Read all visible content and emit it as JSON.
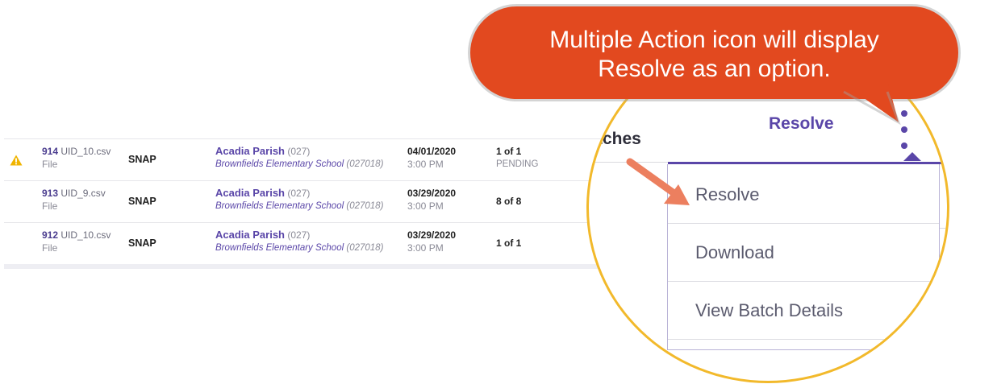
{
  "table": {
    "rows": [
      {
        "warning": true,
        "id": "914",
        "file_name": "UID_10.csv",
        "file_type": "File",
        "program": "SNAP",
        "district": "Acadia Parish",
        "district_code": "(027)",
        "school": "Brownfields Elementary School",
        "school_code": "(027018)",
        "date": "04/01/2020",
        "time": "3:00 PM",
        "count": "1 of 1",
        "status": "PENDING"
      },
      {
        "warning": false,
        "id": "913",
        "file_name": "UID_9.csv",
        "file_type": "File",
        "program": "SNAP",
        "district": "Acadia Parish",
        "district_code": "(027)",
        "school": "Brownfields Elementary School",
        "school_code": "(027018)",
        "date": "03/29/2020",
        "time": "3:00 PM",
        "count": "8 of 8",
        "status": ""
      },
      {
        "warning": false,
        "id": "912",
        "file_name": "UID_10.csv",
        "file_type": "File",
        "program": "SNAP",
        "district": "Acadia Parish",
        "district_code": "(027)",
        "school": "Brownfields Elementary School",
        "school_code": "(027018)",
        "date": "03/29/2020",
        "time": "3:00 PM",
        "count": "1 of 1",
        "status": ""
      }
    ]
  },
  "magnified": {
    "title_fragment": "tches",
    "resolve_label": "Resolve",
    "kebab_icon": "more-vertical-icon",
    "menu_items": [
      "Resolve",
      "Download",
      "View Batch Details"
    ]
  },
  "callout": {
    "line1": "Multiple Action icon will display",
    "line2": "Resolve as an option."
  },
  "colors": {
    "accent": "#5a46a8",
    "callout": "#e2491f",
    "lens_border": "#f2b92b",
    "arrow": "#ec7f5f",
    "warning": "#f0b400"
  }
}
